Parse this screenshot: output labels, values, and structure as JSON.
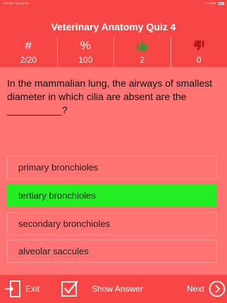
{
  "status_bar": {
    "time": "2:30 AM",
    "date": "Thu Apr 15",
    "wifi_icon": "wifi-icon",
    "battery": "100%",
    "battery_icon": "battery-icon"
  },
  "header": {
    "title": "Veterinary Anatomy Quiz 4"
  },
  "stats": [
    {
      "label": "#",
      "value": "2/20"
    },
    {
      "label": "%",
      "value": "100"
    },
    {
      "icon": "thumbs-up-icon",
      "value": "2"
    },
    {
      "icon": "thumbs-down-icon",
      "value": "0"
    }
  ],
  "question": {
    "text": "In the mammalian lung, the airways of smallest diameter in which cilia are absent are the __________?"
  },
  "options": [
    {
      "label": "primary bronchioles",
      "selected": false
    },
    {
      "label": "tertiary bronchioles",
      "selected": true
    },
    {
      "label": "secondary bronchioles",
      "selected": false
    },
    {
      "label": "alveolar saccules",
      "selected": false
    }
  ],
  "bottom_bar": {
    "exit_label": "Exit",
    "show_answer_label": "Show Answer",
    "next_label": "Next"
  },
  "colors": {
    "background": "#ff7373",
    "bar": "#f54545",
    "selected": "#22ee22",
    "thumbs_up": "#2a9d2a",
    "thumbs_down": "#b31b1b"
  }
}
